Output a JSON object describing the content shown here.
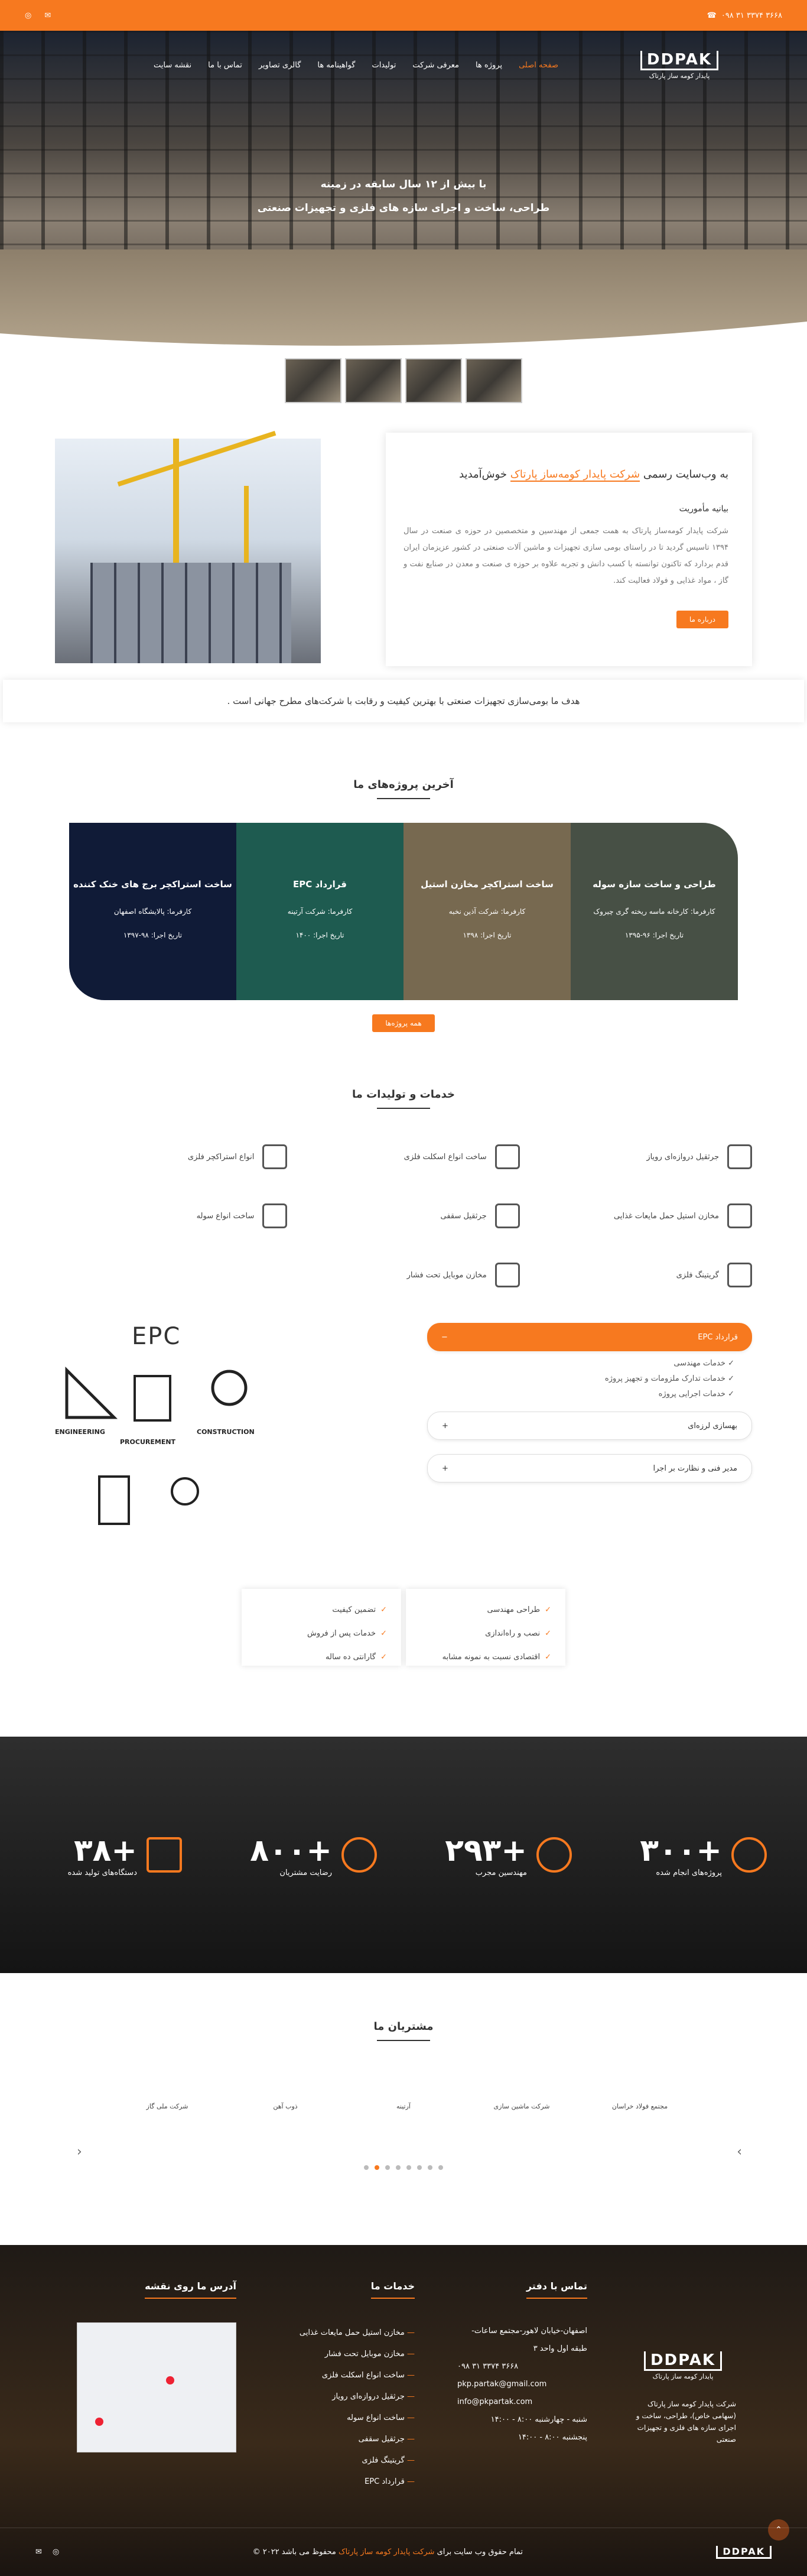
{
  "topbar": {
    "phone": "۰۹۸ ۳۱ ۳۳۷۴ ۳۶۶۸",
    "icons": [
      "email-icon",
      "instagram-icon"
    ]
  },
  "nav": {
    "logo_mark": "DDPAK",
    "logo_text": "پایدار کومه ساز پارتاک",
    "items": [
      "صفحه اصلی",
      "پروژه ها",
      "معرفی شرکت",
      "تولیدات",
      "گواهینامه ها",
      "گالری تصاویر",
      "تماس با ما",
      "نقشه سایت"
    ]
  },
  "hero": {
    "line1": "با بیش از ۱۲ سال سابقه در زمینه",
    "line2": "طراحی، ساخت و اجرای سازه های فلزی و تجهیزات صنعتی"
  },
  "about": {
    "welcome_pre": "به وب‌سایت رسمی",
    "welcome_brand": "شرکت پایدار کومه‌ساز پارتاک",
    "welcome_post": "خوش‌آمدید",
    "subtitle": "بیانیه مأموریت",
    "body": "شرکت پایدار کومه‌ساز پارتاک به همت جمعی از مهندسین و متخصصین در حوزه ی صنعت در سال ۱۳۹۴ تاسیس گردید تا در راستای بومی سازی تجهیزات و ماشین آلات صنعتی در کشور عزیزمان ایران قدم بردارد که تاکنون توانسته با کسب دانش و تجربه علاوه بر حوزه ی صنعت و معدن در صنایع نفت و گاز ، مواد غذایی و فولاد فعالیت کند.",
    "button": "درباره ما"
  },
  "goal": "هدف ما بومی‌سازی تجهیزات صنعتی با بهترین کیفیت و رقابت با شرکت‌های مطرح جهانی است .",
  "projects": {
    "title": "آخرین پروژه‌های ما",
    "items": [
      {
        "title": "طراحی و ساخت سازه سوله",
        "client": "کارفرما: کارخانه ماسه ریخته گری چیروک",
        "date": "تاریخ اجرا: ۹۶-۱۳۹۵",
        "bg": "#6d7b6a"
      },
      {
        "title": "ساخت استراکچر مخازن استیل",
        "client": "کارفرما: شرکت آذین نخبه",
        "date": "تاریخ اجرا: ۱۳۹۸",
        "bg": "#b7a27c"
      },
      {
        "title": "قرارداد EPC",
        "client": "کارفرما: شرکت آرتینه",
        "date": "تاریخ اجرا: ۱۴۰۰",
        "bg": "#2e8d7c"
      },
      {
        "title": "ساخت استراکچر برج های خنک کننده",
        "client": "کارفرما: پالایشگاه اصفهان",
        "date": "تاریخ اجرا: ۹۸-۱۳۹۷",
        "bg": "#1a2a55"
      }
    ],
    "button": "همه پروژه‌ها"
  },
  "services": {
    "title": "خدمات و تولیدات ما",
    "items": [
      {
        "label": "جرثقیل دروازه‌ای رویاز",
        "icon": "gantry-crane-icon"
      },
      {
        "label": "ساخت انواع اسکلت فلزی",
        "icon": "steel-frame-icon"
      },
      {
        "label": "انواع استراکچر فلزی",
        "icon": "warehouse-icon"
      },
      {
        "label": "مخازن استیل حمل مایعات غذایی",
        "icon": "tank-truck-icon"
      },
      {
        "label": "جرثقیل سقفی",
        "icon": "overhead-crane-icon"
      },
      {
        "label": "ساخت انواع سوله",
        "icon": "shed-icon"
      },
      {
        "label": "گریتینگ فلزی",
        "icon": "grating-icon"
      },
      {
        "label": "مخازن موبایل تحت فشار",
        "icon": "pressure-tank-icon"
      }
    ]
  },
  "epc": {
    "heading": "EPC",
    "engineering": "ENGINEERING",
    "procurement": "PROCUREMENT",
    "construction": "CONSTRUCTION",
    "accordion": [
      {
        "title": "قرارداد EPC",
        "open": true,
        "items": [
          "خدمات مهندسی",
          "خدمات تدارک ملزومات و تجهیز پروژه",
          "خدمات اجرایی پروژه"
        ]
      },
      {
        "title": "بهسازی لرزه‌ای",
        "open": false
      },
      {
        "title": "مدیر فنی و نظارت بر اجرا",
        "open": false
      }
    ]
  },
  "checks": [
    [
      "طراحی مهندسی",
      "نصب و راه‌اندازی",
      "اقتصادی نسبت به نمونه مشابه"
    ],
    [
      "تضمین کیفیت",
      "خدمات پس از فروش",
      "گارانتی ده ساله"
    ]
  ],
  "stats": [
    {
      "num": "+۳۰۰",
      "label": "پروژه‌های انجام شده"
    },
    {
      "num": "+۲۹۳",
      "label": "مهندسین مجرب"
    },
    {
      "num": "+۸۰۰",
      "label": "رضایت مشتریان"
    },
    {
      "num": "+۳۸",
      "label": "دستگاه‌های تولید شده"
    }
  ],
  "clients": {
    "title": "مشتریان ما",
    "logos": [
      "مجتمع فولاد خراسان",
      "شرکت ماشین سازی",
      "آرتینه",
      "ذوب آهن",
      "شرکت ملی گاز"
    ]
  },
  "footer": {
    "contact_title": "تماس با دفتر",
    "services_title": "خدمات ما",
    "map_title": "آدرس ما روی نقشه",
    "company_desc": "شرکت پایدار کومه ساز پارتاک (سهامی خاص)، طراحی، ساخت و اجرای سازه های فلزی و تجهیزات صنعتی",
    "address": "اصفهان-خیابان لاهور-مجتمع ساعات- طبقه اول واحد ۳",
    "phone": "۰۹۸ ۳۱ ۳۳۷۴ ۳۶۶۸",
    "email1": "pkp.partak@gmail.com",
    "email2": "info@pkpartak.com",
    "hours1": "شنبه - چهارشنبه ۸:۰۰ - ۱۴:۰۰",
    "hours2": "پنجشنبه ۸:۰۰ - ۱۴:۰۰",
    "services": [
      "مخازن استیل حمل مایعات غذایی",
      "مخازن موبایل تحت فشار",
      "ساخت انواع اسکلت فلزی",
      "جرثقیل دروازه‌ای رویاز",
      "ساخت انواع سوله",
      "جرثقیل سقفی",
      "گریتینگ فلزی",
      "قرارداد EPC"
    ],
    "copyright_pre": "تمام حقوق وب سایت برای",
    "copyright_brand": "شرکت پایدار کومه ساز پارتاک",
    "copyright_post": "محفوظ می باشد ۲۰۲۲ ©"
  }
}
